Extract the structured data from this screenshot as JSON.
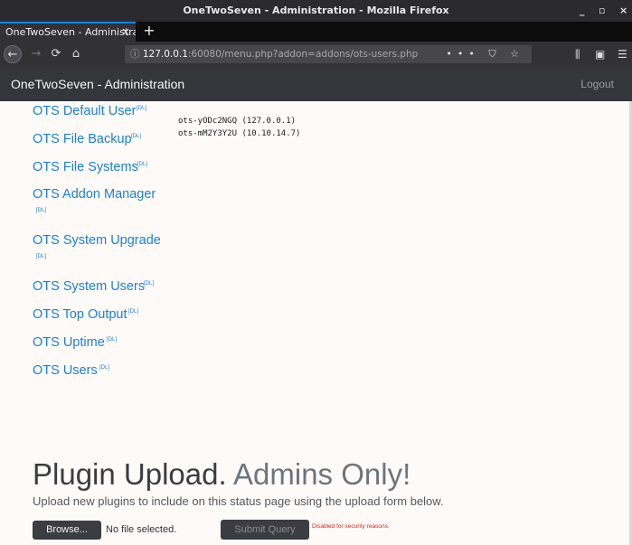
{
  "window": {
    "title": "OneTwoSeven - Administration - Mozilla Firefox",
    "minimize": "_",
    "maximize": "▫",
    "close": "×"
  },
  "tab": {
    "title": "OneTwoSeven - Administrat",
    "close": "×",
    "new_tab": "+"
  },
  "toolbar": {
    "url_host": "127.0.0.1",
    "url_rest": ":60080/menu.php?addon=addons/ots-users.php",
    "page_actions": "••• ⛉ ☆",
    "back": "←",
    "forward": "→",
    "reload": "⟳",
    "home": "⌂",
    "info": "ⓘ",
    "library": "⫼",
    "sidebar": "▣",
    "menu": "☰"
  },
  "site": {
    "brand": "OneTwoSeven - Administration",
    "logout": "Logout"
  },
  "plugins": [
    {
      "label": "OTS Default User",
      "dl": "[DL]"
    },
    {
      "label": "OTS File Backup",
      "dl": "[DL]"
    },
    {
      "label": "OTS File Systems",
      "dl": "[DL]"
    },
    {
      "label": "OTS Addon Manager",
      "dl": "[DL]"
    },
    {
      "label": "OTS System Upgrade",
      "dl": "[DL]"
    },
    {
      "label": "OTS System Users",
      "dl": "[DL]"
    },
    {
      "label": "OTS Top Output",
      "dl": "[DL]"
    },
    {
      "label": "OTS Uptime",
      "dl": "[DL]"
    },
    {
      "label": "OTS Users",
      "dl": "[DL]"
    }
  ],
  "output": {
    "lines": [
      "ots-yODc2NGQ (127.0.0.1)",
      "ots-mM2Y3Y2U (10.10.14.7)"
    ]
  },
  "upload": {
    "title_main": "Plugin Upload.",
    "title_muted": "Admins Only!",
    "subtitle": "Upload new plugins to include on this status page using the upload form below.",
    "browse_label": "Browse...",
    "no_file": "No file selected.",
    "submit_label": "Submit Query",
    "disabled_note": "Disabled for security reasons."
  }
}
